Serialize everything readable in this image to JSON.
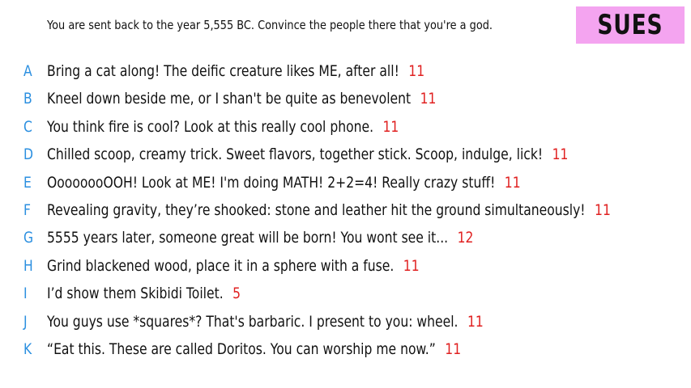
{
  "prompt": "You are sent back to the year 5,555 BC. Convince the people there that you're a god.",
  "badge": {
    "label": "SUES",
    "color": "#f4a4f0"
  },
  "colors": {
    "letter": "#2b8fe0",
    "score": "#e02020",
    "text": "#111111"
  },
  "answers": [
    {
      "letter": "A",
      "text": "Bring a cat along! The deific creature likes ME, after all!",
      "score": "11"
    },
    {
      "letter": "B",
      "text": "Kneel down beside me, or I shan't be quite as benevolent",
      "score": "11"
    },
    {
      "letter": "C",
      "text": "You think fire is cool? Look at this really cool phone.",
      "score": "11"
    },
    {
      "letter": "D",
      "text": "Chilled scoop, creamy trick. Sweet flavors, together stick. Scoop, indulge, lick!",
      "score": "11"
    },
    {
      "letter": "E",
      "text": "OooooooOOH! Look at ME! I'm doing MATH! 2+2=4! Really crazy stuff!",
      "score": "11"
    },
    {
      "letter": "F",
      "text": "Revealing gravity, they’re shooked: stone and leather hit the ground simultaneously!",
      "score": "11"
    },
    {
      "letter": "G",
      "text": "5555 years later, someone great will be born! You wont see it...",
      "score": "12"
    },
    {
      "letter": "H",
      "text": "Grind blackened wood, place it in a sphere with a fuse.",
      "score": "11"
    },
    {
      "letter": "I",
      "text": "I’d show them Skibidi Toilet.",
      "score": "5"
    },
    {
      "letter": "J",
      "text": "You guys use *squares*? That's barbaric. I present to you: wheel.",
      "score": "11"
    },
    {
      "letter": "K",
      "text": "“Eat this. These are called Doritos. You can worship me now.”",
      "score": "11"
    }
  ]
}
